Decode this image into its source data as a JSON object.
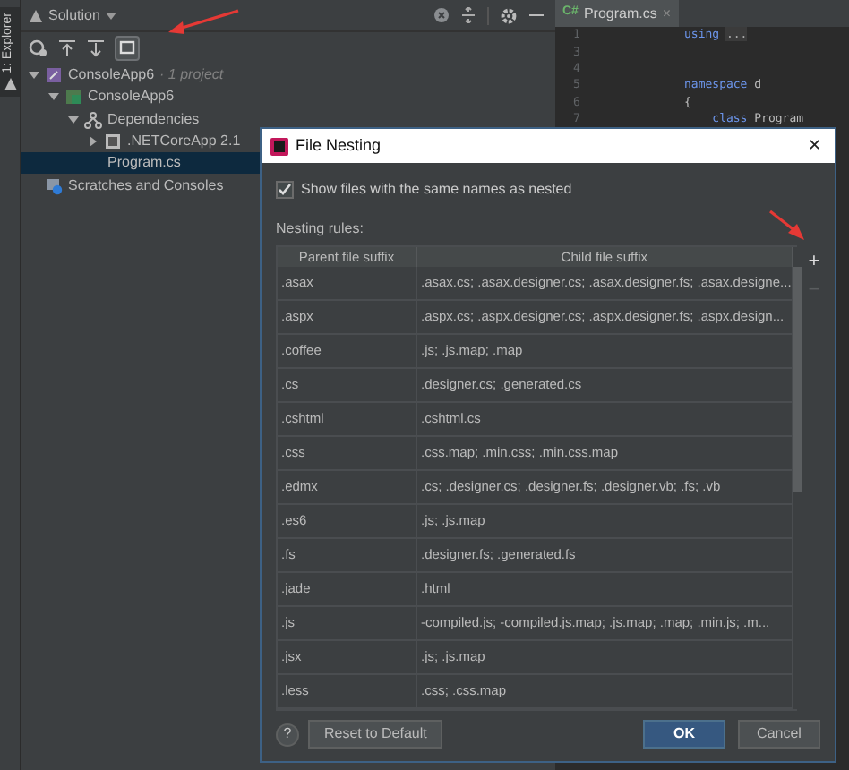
{
  "side_strip": {
    "label": "1: Explorer"
  },
  "explorer": {
    "title": "Solution",
    "tree": [
      {
        "label": "ConsoleApp6",
        "note": "· 1 project",
        "kind": "solution",
        "expanded": true,
        "selected": false,
        "children": [
          {
            "label": "ConsoleApp6",
            "kind": "project",
            "expanded": true,
            "selected": false,
            "children": [
              {
                "label": "Dependencies",
                "kind": "dependencies",
                "expanded": true,
                "selected": false,
                "children": [
                  {
                    "label": ".NETCoreApp 2.1",
                    "kind": "framework",
                    "expanded": false,
                    "selected": false
                  }
                ]
              },
              {
                "label": "Program.cs",
                "kind": "csharp",
                "selected": true
              }
            ]
          }
        ]
      },
      {
        "label": "Scratches and Consoles",
        "kind": "scratches",
        "selected": false
      }
    ]
  },
  "editor": {
    "tab": {
      "badge": "C#",
      "label": "Program.cs",
      "close": "×"
    },
    "lines": [
      {
        "number": "1",
        "segments": [
          {
            "text": "using ",
            "kind": "keyword"
          },
          {
            "text": "...",
            "kind": "folded"
          }
        ]
      },
      {
        "number": "3"
      },
      {
        "number": "4"
      },
      {
        "number": "5",
        "segments": [
          {
            "text": "namespace ",
            "kind": "keyword"
          },
          {
            "text": "d",
            "kind": "plain"
          }
        ]
      },
      {
        "number": "6",
        "segments": [
          {
            "text": "{",
            "kind": "plain"
          }
        ]
      },
      {
        "number": "7",
        "segments": [
          {
            "text": "    class ",
            "kind": "keyword"
          },
          {
            "text": "Program",
            "kind": "plain"
          }
        ]
      }
    ]
  },
  "dialog": {
    "title": "File Nesting",
    "close": "✕",
    "checkbox": {
      "label": "Show files with the same names as nested",
      "checked": true
    },
    "rules_label": "Nesting rules:",
    "columns": [
      "Parent file suffix",
      "Child file suffix"
    ],
    "rows": [
      [
        ".asax",
        ".asax.cs; .asax.designer.cs; .asax.designer.fs; .asax.designe..."
      ],
      [
        ".aspx",
        ".aspx.cs; .aspx.designer.cs; .aspx.designer.fs; .aspx.design..."
      ],
      [
        ".coffee",
        ".js; .js.map; .map"
      ],
      [
        ".cs",
        ".designer.cs; .generated.cs"
      ],
      [
        ".cshtml",
        ".cshtml.cs"
      ],
      [
        ".css",
        ".css.map; .min.css; .min.css.map"
      ],
      [
        ".edmx",
        ".cs; .designer.cs; .designer.fs; .designer.vb; .fs; .vb"
      ],
      [
        ".es6",
        ".js; .js.map"
      ],
      [
        ".fs",
        ".designer.fs; .generated.fs"
      ],
      [
        ".jade",
        ".html"
      ],
      [
        ".js",
        "-compiled.js; -compiled.js.map; .js.map; .map; .min.js; .m..."
      ],
      [
        ".jsx",
        ".js; .js.map"
      ],
      [
        ".less",
        ".css; .css.map"
      ]
    ],
    "side_buttons": [
      {
        "label": "+",
        "disabled": false
      },
      {
        "label": "−",
        "disabled": true
      }
    ],
    "help": "?",
    "buttons": [
      {
        "label": "Reset to Default",
        "primary": false
      },
      {
        "label": "OK",
        "primary": true
      },
      {
        "label": "Cancel",
        "primary": false
      }
    ]
  }
}
